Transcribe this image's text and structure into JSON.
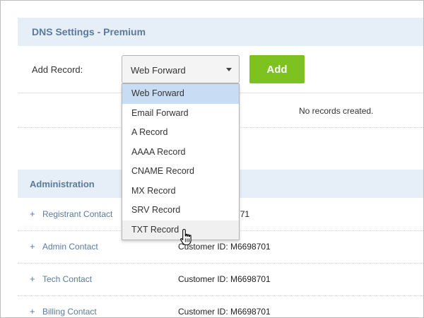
{
  "dns": {
    "title": "DNS Settings - Premium",
    "add_record_label": "Add Record:",
    "selected_type": "Web Forward",
    "add_button_label": "Add",
    "empty_message": "No records created.",
    "record_types": [
      "Web Forward",
      "Email Forward",
      "A Record",
      "AAAA Record",
      "CNAME Record",
      "MX Record",
      "SRV Record",
      "TXT Record"
    ],
    "hovered_option": "TXT Record"
  },
  "administration": {
    "title": "Administration",
    "rows": [
      {
        "label": "Registrant Contact",
        "value": "995871"
      },
      {
        "label": "Admin Contact",
        "value": "Customer ID: M6698701"
      },
      {
        "label": "Tech Contact",
        "value": "Customer ID: M6698701"
      },
      {
        "label": "Billing Contact",
        "value": "Customer ID: M6698701"
      }
    ]
  },
  "colors": {
    "header_bg": "#e6eef7",
    "header_text": "#5b7a9c",
    "add_button": "#7dc21f",
    "selected_option_bg": "#c8ddf3",
    "hovered_option_bg": "#f0f0f0"
  },
  "icons": {
    "caret": "caret-down-icon",
    "cursor": "hand-pointer-icon",
    "expand": "plus-icon"
  }
}
